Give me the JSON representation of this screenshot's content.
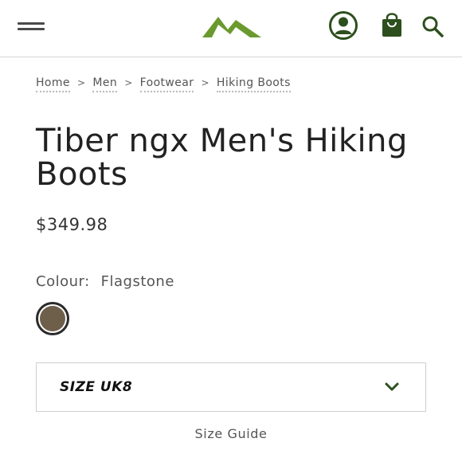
{
  "header": {
    "menu_icon": "hamburger-menu-icon",
    "logo_icon": "mountain-logo-icon",
    "account_icon": "account-icon",
    "bag_icon": "shopping-bag-icon",
    "search_icon": "search-icon",
    "brand_color": "#6a9a2e",
    "icon_color": "#2d4f1e"
  },
  "breadcrumb": {
    "items": [
      "Home",
      "Men",
      "Footwear",
      "Hiking Boots"
    ],
    "separator": ">"
  },
  "product": {
    "title": "Tiber ngx Men's Hiking Boots",
    "price": "$349.98",
    "colour_label": "Colour:",
    "colour_value": "Flagstone",
    "swatch_color": "#6e5f4b"
  },
  "size_selector": {
    "label": "SIZE UK8",
    "chevron_icon": "chevron-down-icon"
  },
  "size_guide": {
    "label": "Size Guide"
  }
}
